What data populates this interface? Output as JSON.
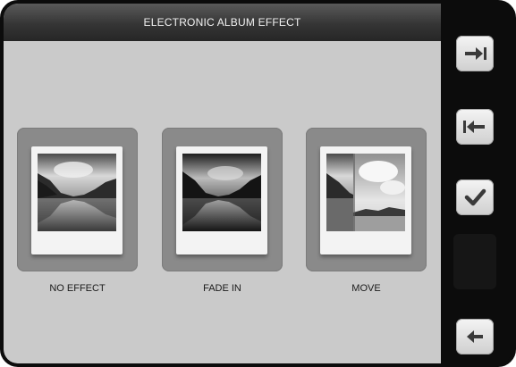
{
  "header": {
    "title": "ELECTRONIC ALBUM EFFECT"
  },
  "options": [
    {
      "label": "NO EFFECT",
      "image": "lake-mountain-photo"
    },
    {
      "label": "FADE IN",
      "image": "lake-mountain-photo-dark"
    },
    {
      "label": "MOVE",
      "image": "lake-mountain-photo-sliding"
    }
  ],
  "sidebar": {
    "buttons": [
      {
        "icon": "arrow-right-bar-icon"
      },
      {
        "icon": "arrow-left-bar-icon"
      },
      {
        "icon": "checkmark-icon"
      },
      {
        "icon": "back-arrow-icon"
      }
    ]
  },
  "colors": {
    "frame": "#0c0c0c",
    "panel": "#c9c9c9",
    "header": "#353535",
    "card": "#8a8a8a"
  }
}
